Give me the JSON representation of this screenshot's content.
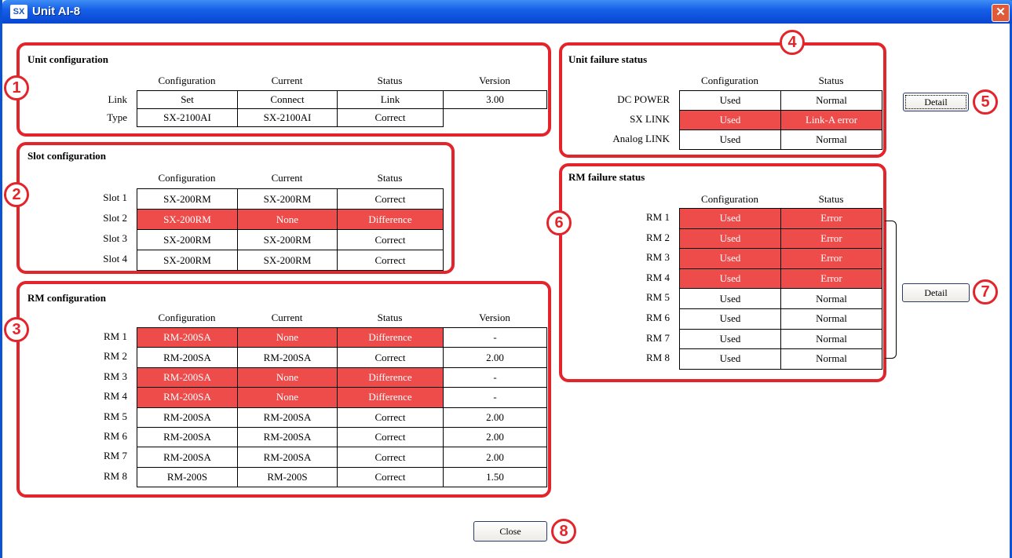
{
  "window": {
    "title": "Unit AI-8",
    "icon": "SX",
    "close_glyph": "✕"
  },
  "callouts": [
    "1",
    "2",
    "3",
    "4",
    "5",
    "6",
    "7",
    "8"
  ],
  "unit_config": {
    "title": "Unit configuration",
    "headers": [
      "Configuration",
      "Current",
      "Status",
      "Version"
    ],
    "rows": [
      {
        "label": "Link",
        "cells": [
          "Set",
          "Connect",
          "Link",
          "3.00"
        ]
      },
      {
        "label": "Type",
        "cells": [
          "SX-2100AI",
          "SX-2100AI",
          "Correct",
          ""
        ]
      }
    ]
  },
  "slot_config": {
    "title": "Slot configuration",
    "headers": [
      "Configuration",
      "Current",
      "Status"
    ],
    "rows": [
      {
        "label": "Slot 1",
        "cells": [
          "SX-200RM",
          "SX-200RM",
          "Correct"
        ],
        "error": false
      },
      {
        "label": "Slot 2",
        "cells": [
          "SX-200RM",
          "None",
          "Difference"
        ],
        "error": true
      },
      {
        "label": "Slot 3",
        "cells": [
          "SX-200RM",
          "SX-200RM",
          "Correct"
        ],
        "error": false
      },
      {
        "label": "Slot 4",
        "cells": [
          "SX-200RM",
          "SX-200RM",
          "Correct"
        ],
        "error": false
      }
    ]
  },
  "rm_config": {
    "title": "RM configuration",
    "headers": [
      "Configuration",
      "Current",
      "Status",
      "Version"
    ],
    "rows": [
      {
        "label": "RM 1",
        "cells": [
          "RM-200SA",
          "None",
          "Difference",
          "-"
        ],
        "error": true
      },
      {
        "label": "RM 2",
        "cells": [
          "RM-200SA",
          "RM-200SA",
          "Correct",
          "2.00"
        ],
        "error": false
      },
      {
        "label": "RM 3",
        "cells": [
          "RM-200SA",
          "None",
          "Difference",
          "-"
        ],
        "error": true
      },
      {
        "label": "RM 4",
        "cells": [
          "RM-200SA",
          "None",
          "Difference",
          "-"
        ],
        "error": true
      },
      {
        "label": "RM 5",
        "cells": [
          "RM-200SA",
          "RM-200SA",
          "Correct",
          "2.00"
        ],
        "error": false
      },
      {
        "label": "RM 6",
        "cells": [
          "RM-200SA",
          "RM-200SA",
          "Correct",
          "2.00"
        ],
        "error": false
      },
      {
        "label": "RM 7",
        "cells": [
          "RM-200SA",
          "RM-200SA",
          "Correct",
          "2.00"
        ],
        "error": false
      },
      {
        "label": "RM 8",
        "cells": [
          "RM-200S",
          "RM-200S",
          "Correct",
          "1.50"
        ],
        "error": false
      }
    ]
  },
  "unit_failure": {
    "title": "Unit failure status",
    "headers": [
      "Configuration",
      "Status"
    ],
    "rows": [
      {
        "label": "DC POWER",
        "cells": [
          "Used",
          "Normal"
        ],
        "error": false
      },
      {
        "label": "SX LINK",
        "cells": [
          "Used",
          "Link-A error"
        ],
        "error": true
      },
      {
        "label": "Analog LINK",
        "cells": [
          "Used",
          "Normal"
        ],
        "error": false
      }
    ],
    "detail_label": "Detail"
  },
  "rm_failure": {
    "title": "RM failure status",
    "headers": [
      "Configuration",
      "Status"
    ],
    "rows": [
      {
        "label": "RM 1",
        "cells": [
          "Used",
          "Error"
        ],
        "error": true
      },
      {
        "label": "RM 2",
        "cells": [
          "Used",
          "Error"
        ],
        "error": true
      },
      {
        "label": "RM 3",
        "cells": [
          "Used",
          "Error"
        ],
        "error": true
      },
      {
        "label": "RM 4",
        "cells": [
          "Used",
          "Error"
        ],
        "error": true
      },
      {
        "label": "RM 5",
        "cells": [
          "Used",
          "Normal"
        ],
        "error": false
      },
      {
        "label": "RM 6",
        "cells": [
          "Used",
          "Normal"
        ],
        "error": false
      },
      {
        "label": "RM 7",
        "cells": [
          "Used",
          "Normal"
        ],
        "error": false
      },
      {
        "label": "RM 8",
        "cells": [
          "Used",
          "Normal"
        ],
        "error": false
      }
    ],
    "detail_label": "Detail"
  },
  "close_label": "Close",
  "colors": {
    "error_bg": "#ee4b4b",
    "callout": "#e3252b",
    "titlebar": "#1660e8"
  }
}
